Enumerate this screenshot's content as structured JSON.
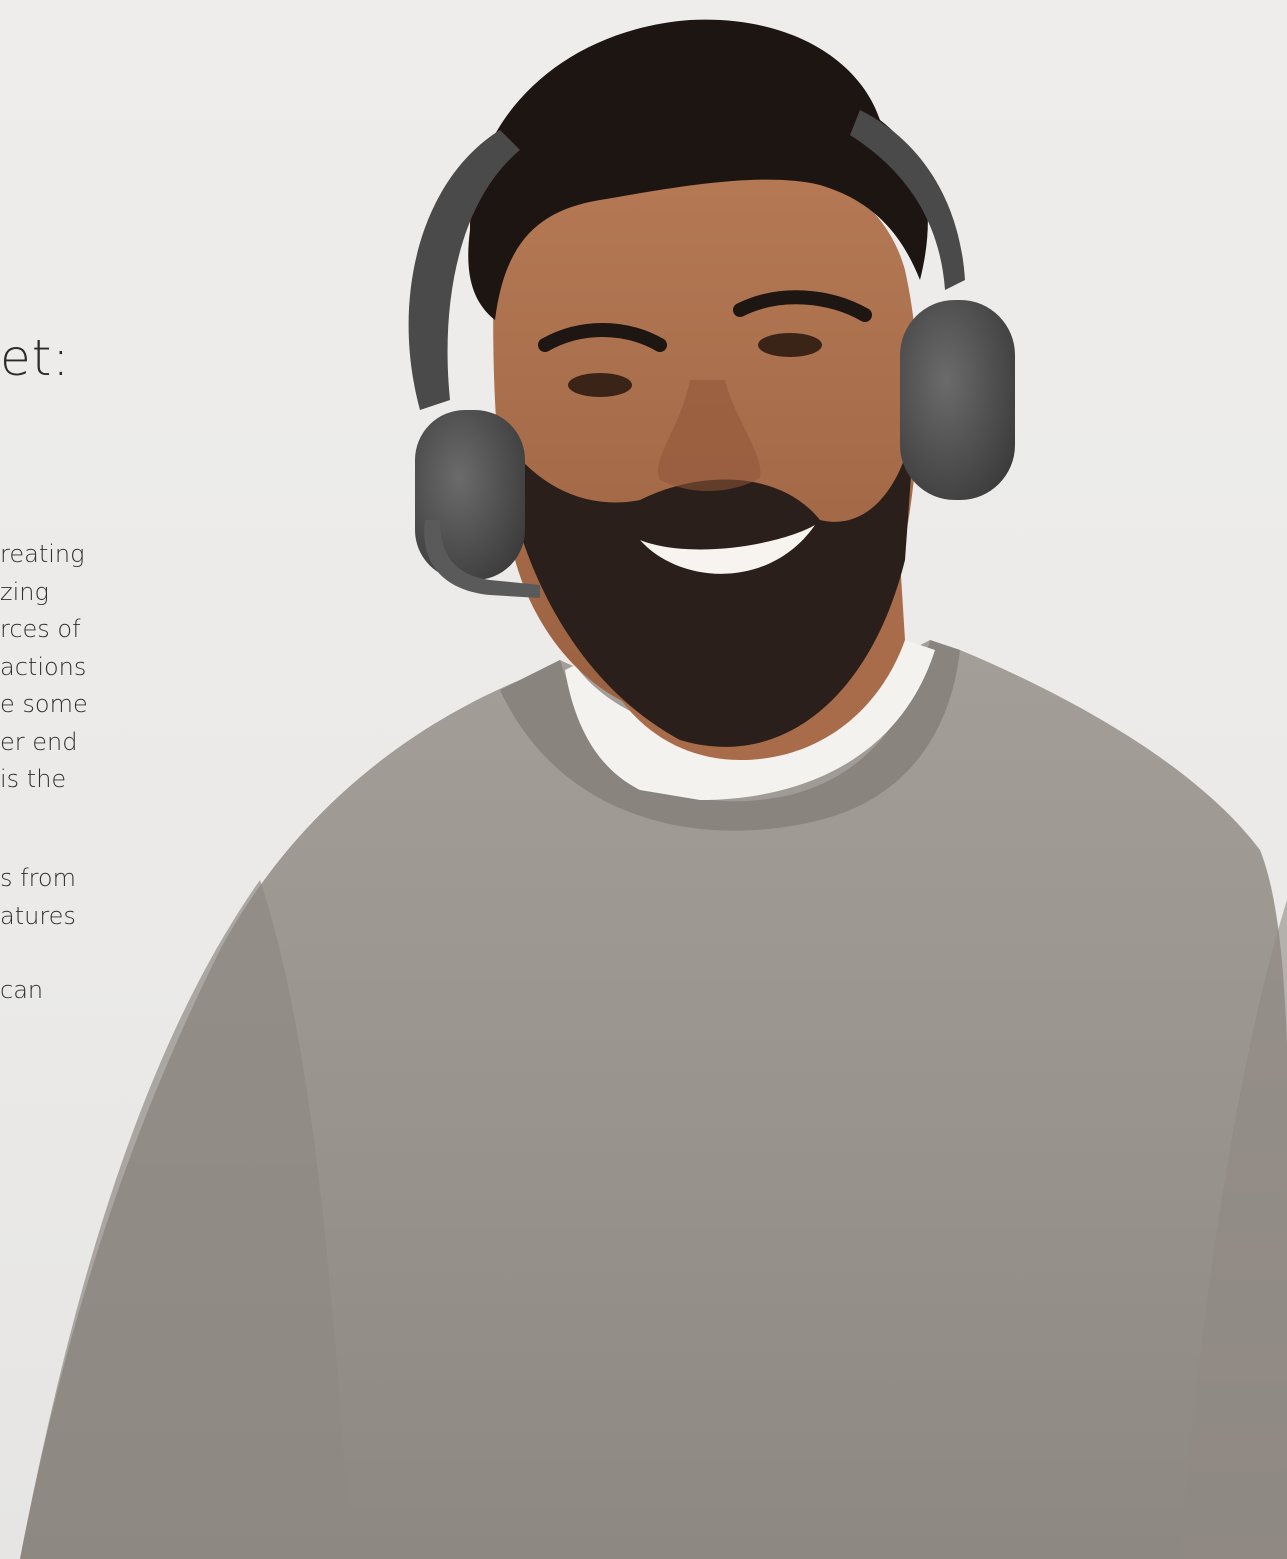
{
  "headline": "et:",
  "body": {
    "paragraph_1": [
      "reating",
      "zing",
      "rces of",
      "actions",
      "e some",
      "er end",
      "is the"
    ],
    "paragraph_2": [
      "s from",
      "atures"
    ],
    "paragraph_3": [
      "can"
    ]
  },
  "colors": {
    "background": "#ecebe9",
    "sweater": "#9b958f",
    "headset": "#4a4a4a",
    "text": "#2f2f2f"
  }
}
